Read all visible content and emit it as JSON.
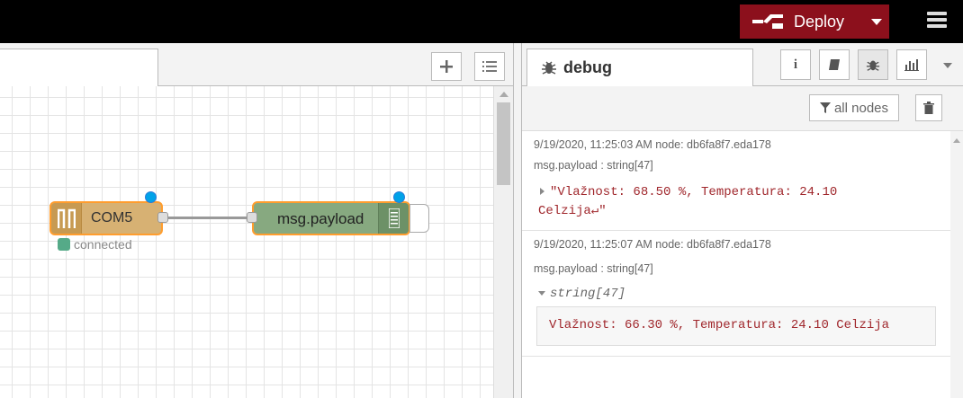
{
  "header": {
    "deploy_label": "Deploy"
  },
  "flow": {
    "nodes": [
      {
        "label": "COM5",
        "status": "connected"
      },
      {
        "label": "msg.payload"
      }
    ]
  },
  "sidebar": {
    "tab_label": "debug",
    "filter_label": "all nodes",
    "messages": [
      {
        "meta": "9/19/2020, 11:25:03 AM   node: db6fa8f7.eda178",
        "topic": "msg.payload : string[47]",
        "body_line1": "\"Vlažnost: 68.50 %, Temperatura: 24.10",
        "body_line2": "Celzija↵\""
      },
      {
        "meta": "9/19/2020, 11:25:07 AM   node: db6fa8f7.eda178",
        "topic": "msg.payload : string[47]",
        "type": "string[47]",
        "value": "Vlažnost: 66.30 %, Temperatura: 24.10 Celzija"
      }
    ]
  }
}
